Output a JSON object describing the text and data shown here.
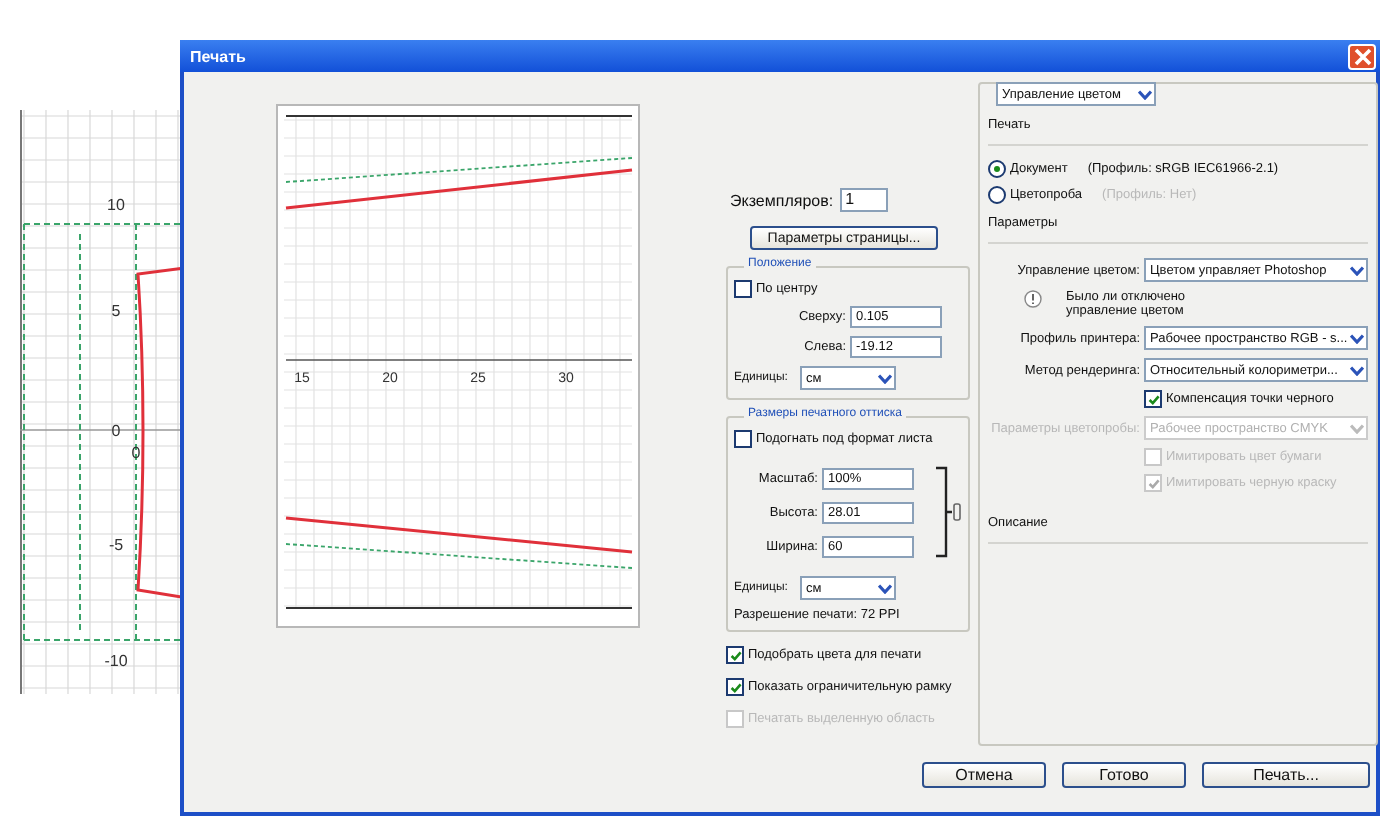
{
  "background_drawing": {
    "y_labels": [
      "10",
      "5",
      "0",
      "-5",
      "-10"
    ],
    "x_labels": [
      "0"
    ]
  },
  "window": {
    "title": "Печать"
  },
  "preview": {
    "axis_labels": [
      "15",
      "20",
      "25",
      "30"
    ]
  },
  "copies": {
    "label": "Экземпляров:",
    "value": "1"
  },
  "page_setup_button": "Параметры страницы...",
  "position": {
    "title": "Положение",
    "center": {
      "label": "По центру",
      "checked": false
    },
    "fields": [
      {
        "label": "Сверху:",
        "value": "0.105"
      },
      {
        "label": "Слева:",
        "value": "-19.12"
      }
    ],
    "units": {
      "label": "Единицы:",
      "value": "см"
    }
  },
  "print_size": {
    "title": "Размеры печатного оттиска",
    "fit": {
      "label": "Подогнать под формат листа",
      "checked": false
    },
    "fields": [
      {
        "label": "Масштаб:",
        "value": "100%"
      },
      {
        "label": "Высота:",
        "value": "28.01"
      },
      {
        "label": "Ширина:",
        "value": "60"
      }
    ],
    "units": {
      "label": "Единицы:",
      "value": "см"
    },
    "resolution": "Разрешение печати: 72 PPI"
  },
  "options": [
    {
      "label": "Подобрать цвета для печати",
      "checked": true,
      "disabled": false
    },
    {
      "label": "Показать ограничительную рамку",
      "checked": true,
      "disabled": false
    },
    {
      "label": "Печатать выделенную область",
      "checked": false,
      "disabled": true
    }
  ],
  "color_panel": {
    "mode": "Управление цветом",
    "print_label": "Печать",
    "sources": [
      {
        "label": "Документ",
        "profile": "(Профиль: sRGB IEC61966-2.1)",
        "selected": true
      },
      {
        "label": "Цветопроба",
        "profile": "(Профиль: Нет)",
        "selected": false
      }
    ],
    "params_label": "Параметры",
    "rows": [
      {
        "kind": "select",
        "label": "Управление цветом:",
        "value": "Цветом управляет Photoshop",
        "disabled": false
      },
      {
        "kind": "note",
        "text": "Было ли отключено управление цветом"
      },
      {
        "kind": "select",
        "label": "Профиль принтера:",
        "value": "Рабочее пространство RGB - s...",
        "disabled": false
      },
      {
        "kind": "select",
        "label": "Метод рендеринга:",
        "value": "Относительный колориметри...",
        "disabled": false
      },
      {
        "kind": "check",
        "label": "Компенсация точки черного",
        "checked": true,
        "disabled": false
      },
      {
        "kind": "select",
        "label": "Параметры цветопробы:",
        "value": "Рабочее пространство CMYK",
        "disabled": true
      },
      {
        "kind": "check",
        "label": "Имитировать цвет бумаги",
        "checked": false,
        "disabled": true
      },
      {
        "kind": "check",
        "label": "Имитировать черную краску",
        "checked": true,
        "disabled": true
      }
    ],
    "description_label": "Описание"
  },
  "buttons": [
    {
      "label": "Отмена",
      "default": false
    },
    {
      "label": "Готово",
      "default": false
    },
    {
      "label": "Печать...",
      "default": true
    }
  ]
}
